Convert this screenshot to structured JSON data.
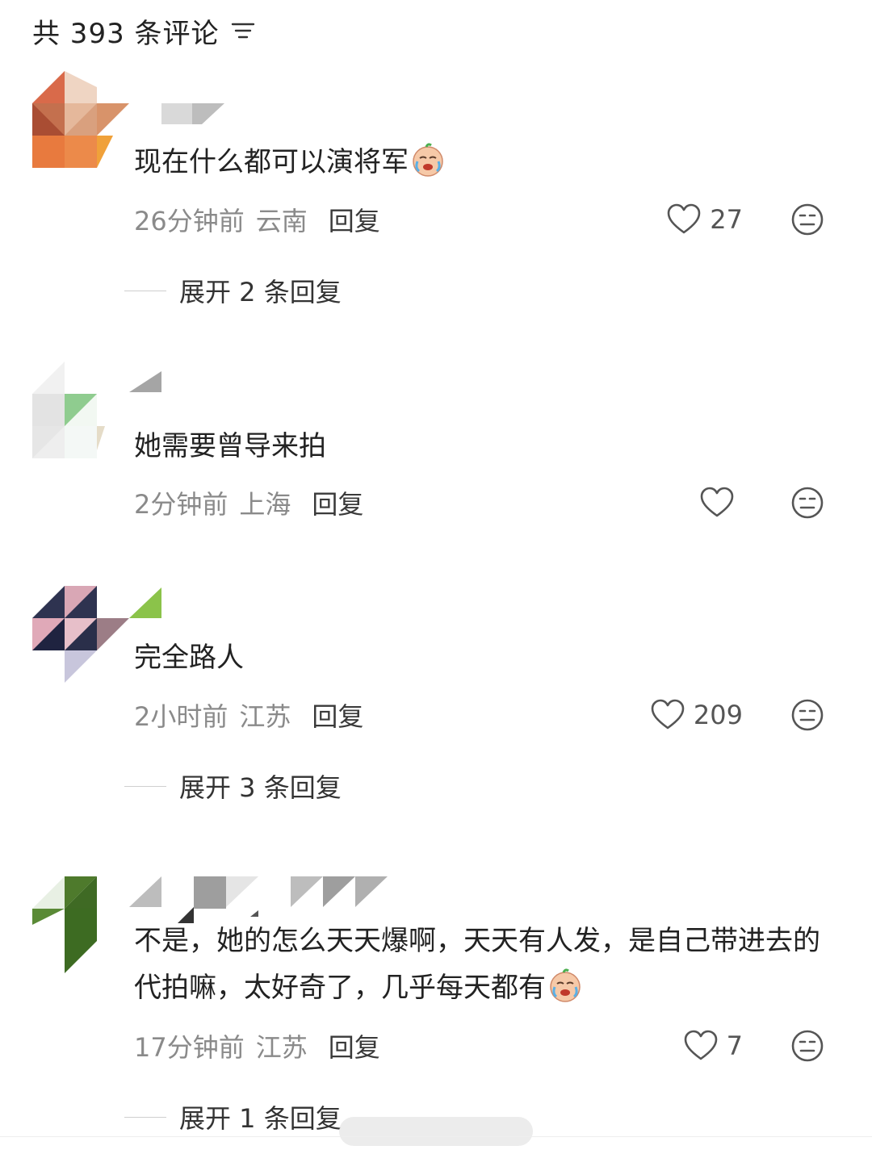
{
  "header": {
    "title": "共 393 条评论",
    "sort_icon": "filter-lines-icon"
  },
  "comments": [
    {
      "text": "现在什么都可以演将军",
      "emoji": "crying-emoji",
      "time": "26分钟前",
      "location": "云南",
      "reply": "回复",
      "likes": "27",
      "expand": "展开 2 条回复"
    },
    {
      "text": "她需要曾导来拍",
      "time": "2分钟前",
      "location": "上海",
      "reply": "回复",
      "likes": ""
    },
    {
      "text": "完全路人",
      "time": "2小时前",
      "location": "江苏",
      "reply": "回复",
      "likes": "209",
      "expand": "展开 3 条回复"
    },
    {
      "text": "不是，她的怎么天天爆啊，天天有人发，是自己带进去的代拍嘛，太好奇了，几乎每天都有",
      "emoji": "crying-emoji",
      "time": "17分钟前",
      "location": "江苏",
      "reply": "回复",
      "likes": "7",
      "expand": "展开 1 条回复"
    }
  ],
  "colors": {
    "meta_gray": "#8a8a8a",
    "text": "#222222",
    "icon": "#555555"
  }
}
